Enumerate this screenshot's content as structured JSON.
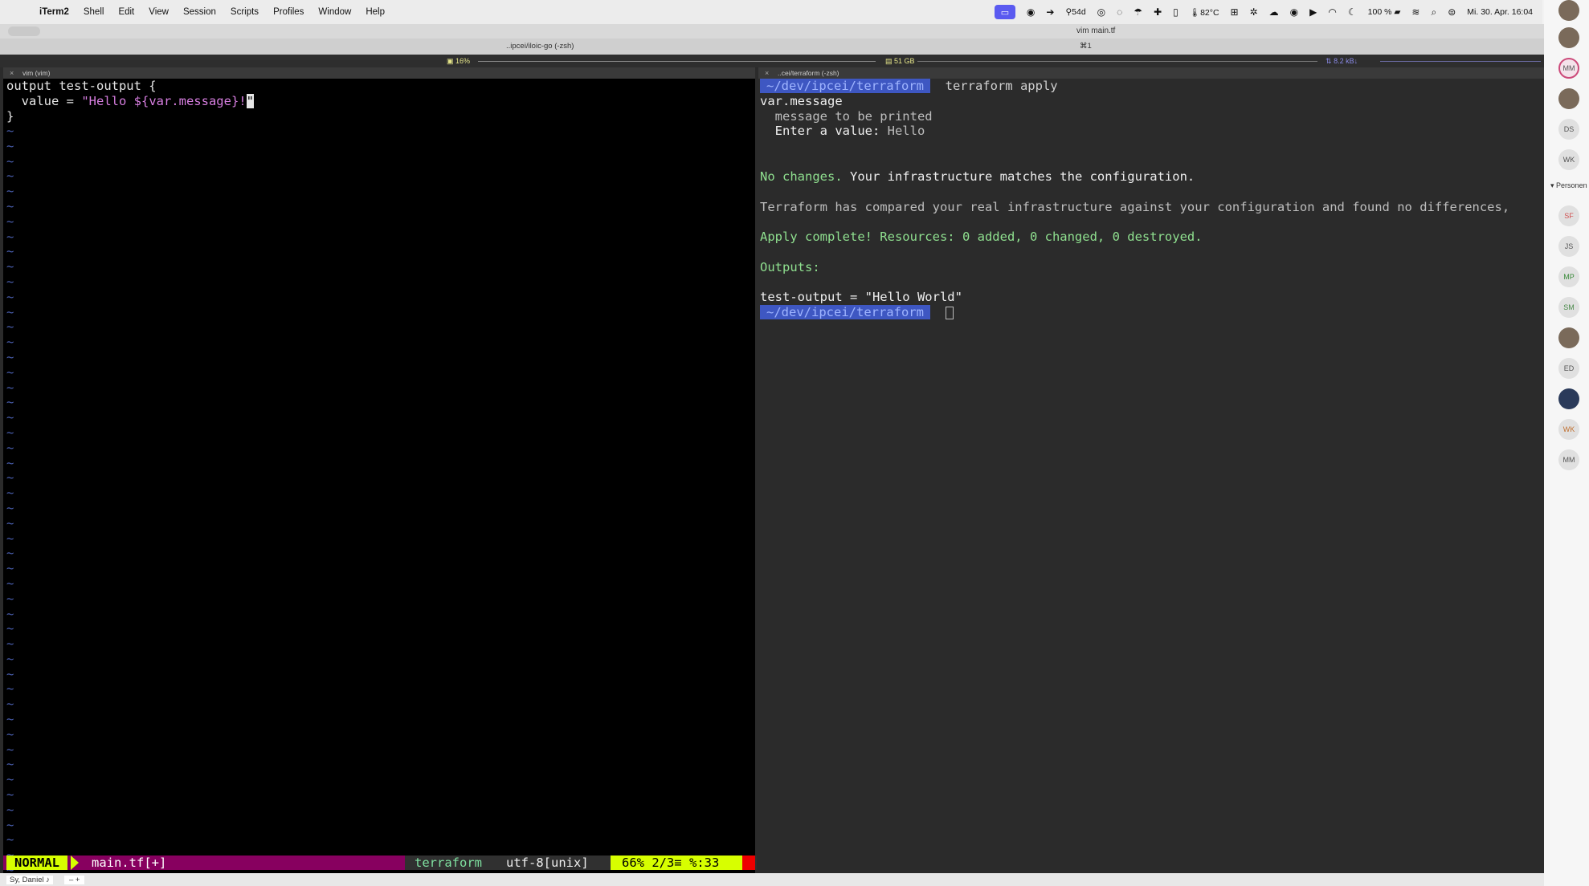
{
  "menubar": {
    "items": [
      "iTerm2",
      "Shell",
      "Edit",
      "View",
      "Session",
      "Scripts",
      "Profiles",
      "Window",
      "Help"
    ],
    "status": {
      "uptime": "54d",
      "temperature": "82°C",
      "battery": "100 %",
      "datetime": "Mi. 30. Apr.  16:04"
    }
  },
  "window": {
    "title": "vim main.tf",
    "tab_left": "..ipcei/iloic-go (-zsh)",
    "tab_right_shortcut": "⌘1",
    "status_cpu": "16%",
    "status_mem": "51 GB",
    "status_net": "8.2 kB↓"
  },
  "panes": {
    "left_title": "vim (vim)",
    "right_title": "..cei/terraform (-zsh)"
  },
  "vim": {
    "lines": [
      "output test-output {",
      "  value = \"Hello ${var.message}!\"",
      "}"
    ],
    "line2_prefix": "  value = ",
    "line2_string": "\"Hello ${var.message}!",
    "line2_cursor_char": "\"",
    "statusline": {
      "mode": "NORMAL",
      "file": "main.tf[+]",
      "filetype": "terraform",
      "encoding": "utf-8[unix]",
      "position": "66%  2/3≡ %:33"
    }
  },
  "terminal": {
    "prompt_path": "~/dev/ipcei/terraform",
    "command": "terraform apply",
    "var_name": "var.message",
    "var_desc": "  message to be printed",
    "enter_label": "  Enter a value: ",
    "enter_value": "Hello",
    "no_changes": "No changes.",
    "no_changes_rest": " Your infrastructure matches the configuration.",
    "compared": "Terraform has compared your real infrastructure against your configuration and found no differences,",
    "apply_complete": "Apply complete! Resources: 0 added, 0 changed, 0 destroyed.",
    "outputs_label": "Outputs:",
    "output_line": "test-output = \"Hello World\""
  },
  "bottombar": {
    "user": "Sy, Daniel",
    "controls": "–  +"
  },
  "sidebar": {
    "group_label": "Personen",
    "avatars": [
      "MM",
      "DS",
      "WK",
      "SF",
      "JS",
      "MP",
      "SM",
      "ED",
      "WK",
      "MM"
    ]
  },
  "colors": {
    "vim_mode_bg": "#d7ff00",
    "vim_file_bg": "#87005f",
    "prompt_bg": "#3e57c2",
    "terminal_green": "#8fe08f"
  }
}
